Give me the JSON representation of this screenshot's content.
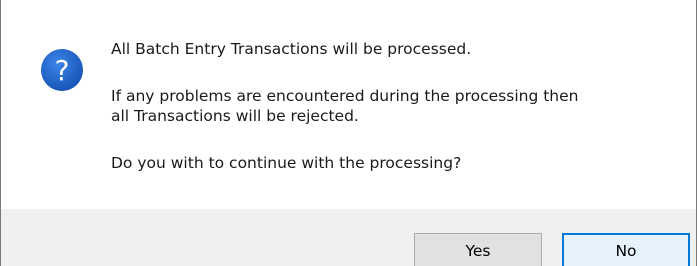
{
  "dialog": {
    "icon": "question-icon",
    "accent_color": "#1a5ec4",
    "messages": [
      "All Batch Entry Transactions will be processed.",
      "If any problems are encountered during the processing then\nall Transactions will be rejected.",
      "Do you with to continue with the processing?"
    ],
    "buttons": {
      "yes_label": "Yes",
      "no_label": "No",
      "default_button": "No"
    }
  }
}
